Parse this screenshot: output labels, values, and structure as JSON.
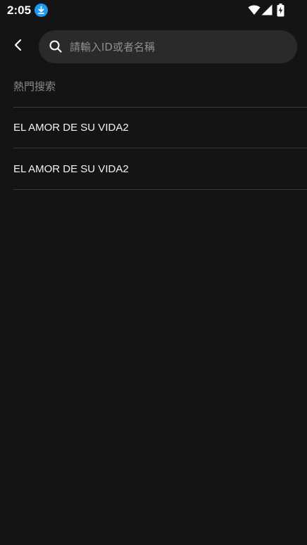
{
  "status_bar": {
    "time": "2:05",
    "icons": [
      "download-icon",
      "wifi-icon",
      "signal-icon",
      "battery-charging-icon"
    ]
  },
  "search": {
    "placeholder": "請輸入ID或者名稱",
    "value": ""
  },
  "hot_search": {
    "title": "熱門搜索",
    "items": [
      {
        "label": "EL AMOR DE SU VIDA2"
      },
      {
        "label": "EL AMOR DE SU VIDA2"
      }
    ]
  },
  "colors": {
    "background": "#141414",
    "search_box": "#2a2a2a",
    "divider": "#3a3a3a",
    "muted_text": "#8a8a8a",
    "download_badge": "#1e9bf0"
  }
}
